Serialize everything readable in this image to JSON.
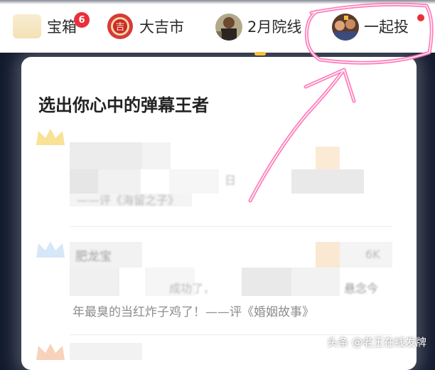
{
  "tabs": [
    {
      "label": "宝箱",
      "icon": "treasure-box-icon",
      "badge": "6"
    },
    {
      "label": "大吉市",
      "icon": "lucky-seal-icon"
    },
    {
      "label": "2月院线",
      "icon": "movie-poster-avatar"
    },
    {
      "label": "一起投",
      "icon": "group-vote-avatar",
      "has_dot": true
    }
  ],
  "card": {
    "title": "选出你心中的弹幕王者",
    "entries": [
      {
        "rank_icon": "gold-crown-icon",
        "quote_tail": "日",
        "movie_ref": "——评《海留之子》"
      },
      {
        "rank_icon": "silver-crown-icon",
        "user": "肥龙宝",
        "count": "6K",
        "line1": "成功了，",
        "line1_end": "悬念今",
        "line2": "年最臭的当红炸子鸡了！——评《婚姻故事》"
      },
      {
        "rank_icon": "bronze-crown-icon"
      }
    ]
  },
  "watermark": "头条 @老王在线发牌",
  "colors": {
    "badge": "#e9303a",
    "indicator": "#f7b713",
    "annotation": "#ff6fb4"
  }
}
